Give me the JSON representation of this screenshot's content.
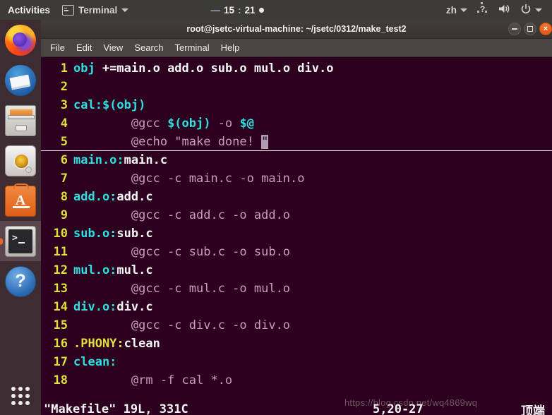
{
  "topbar": {
    "activities": "Activities",
    "app_menu": {
      "label": "Terminal",
      "icon": "terminal-icon"
    },
    "clock": {
      "dash": "—",
      "hours": "15",
      "separator": ":",
      "minutes": "21"
    },
    "input_method": "zh",
    "icons": {
      "ime": "ime-question-icon",
      "volume": "volume-icon",
      "power": "power-icon",
      "menu_arrow": "chevron-down-icon"
    }
  },
  "dock": {
    "items": [
      {
        "name": "firefox",
        "label": "Firefox",
        "active": false
      },
      {
        "name": "thunderbird",
        "label": "Thunderbird Mail",
        "active": false
      },
      {
        "name": "files",
        "label": "Files",
        "active": false
      },
      {
        "name": "rhythmbox",
        "label": "Rhythmbox",
        "active": false
      },
      {
        "name": "ubuntu-software",
        "label": "Ubuntu Software",
        "glyph": "A",
        "active": false
      },
      {
        "name": "terminal",
        "label": "Terminal",
        "active": true
      },
      {
        "name": "help",
        "label": "Help",
        "glyph": "?",
        "active": false
      }
    ],
    "show_applications": "Show Applications"
  },
  "window": {
    "title": "root@jsetc-virtual-machine: ~/jsetc/0312/make_test2",
    "buttons": {
      "minimize": "minimize-button",
      "maximize": "maximize-button",
      "close": "×"
    },
    "menu": [
      "File",
      "Edit",
      "View",
      "Search",
      "Terminal",
      "Help"
    ]
  },
  "editor": {
    "lines": [
      {
        "n": "1",
        "cursorline": false,
        "parts": [
          {
            "t": "obj",
            "c": "c-target"
          },
          {
            "t": " +=main.o add.o sub.o mul.o div.o",
            "c": "c-white"
          }
        ]
      },
      {
        "n": "2",
        "cursorline": false,
        "parts": []
      },
      {
        "n": "3",
        "cursorline": false,
        "parts": [
          {
            "t": "cal:$(obj)",
            "c": "c-target"
          }
        ]
      },
      {
        "n": "4",
        "cursorline": false,
        "parts": [
          {
            "t": "        @gcc ",
            "c": "c-cmd"
          },
          {
            "t": "$(obj)",
            "c": "c-var"
          },
          {
            "t": " -o ",
            "c": "c-cmd"
          },
          {
            "t": "$@",
            "c": "c-var"
          }
        ]
      },
      {
        "n": "5",
        "cursorline": true,
        "parts": [
          {
            "t": "        @echo \"make done! ",
            "c": "c-cmd"
          },
          {
            "t": "\"",
            "c": "c-cmd cursor-blk"
          }
        ]
      },
      {
        "n": "6",
        "cursorline": false,
        "parts": [
          {
            "t": "main.o:",
            "c": "c-target"
          },
          {
            "t": "main.c",
            "c": "c-white"
          }
        ]
      },
      {
        "n": "7",
        "cursorline": false,
        "parts": [
          {
            "t": "        @gcc -c main.c -o main.o",
            "c": "c-cmd"
          }
        ]
      },
      {
        "n": "8",
        "cursorline": false,
        "parts": [
          {
            "t": "add.o:",
            "c": "c-target"
          },
          {
            "t": "add.c",
            "c": "c-white"
          }
        ]
      },
      {
        "n": "9",
        "cursorline": false,
        "parts": [
          {
            "t": "        @gcc -c add.c -o add.o",
            "c": "c-cmd"
          }
        ]
      },
      {
        "n": "10",
        "cursorline": false,
        "parts": [
          {
            "t": "sub.o:",
            "c": "c-target"
          },
          {
            "t": "sub.c",
            "c": "c-white"
          }
        ]
      },
      {
        "n": "11",
        "cursorline": false,
        "parts": [
          {
            "t": "        @gcc -c sub.c -o sub.o",
            "c": "c-cmd"
          }
        ]
      },
      {
        "n": "12",
        "cursorline": false,
        "parts": [
          {
            "t": "mul.o:",
            "c": "c-target"
          },
          {
            "t": "mul.c",
            "c": "c-white"
          }
        ]
      },
      {
        "n": "13",
        "cursorline": false,
        "parts": [
          {
            "t": "        @gcc -c mul.c -o mul.o",
            "c": "c-cmd"
          }
        ]
      },
      {
        "n": "14",
        "cursorline": false,
        "parts": [
          {
            "t": "div.o:",
            "c": "c-target"
          },
          {
            "t": "div.c",
            "c": "c-white"
          }
        ]
      },
      {
        "n": "15",
        "cursorline": false,
        "parts": [
          {
            "t": "        @gcc -c div.c -o div.o",
            "c": "c-cmd"
          }
        ]
      },
      {
        "n": "16",
        "cursorline": false,
        "parts": [
          {
            "t": ".PHONY:",
            "c": "c-yellow"
          },
          {
            "t": "clean",
            "c": "c-white"
          }
        ]
      },
      {
        "n": "17",
        "cursorline": false,
        "parts": [
          {
            "t": "clean:",
            "c": "c-target"
          }
        ]
      },
      {
        "n": "18",
        "cursorline": false,
        "parts": [
          {
            "t": "        @rm -f cal *.o",
            "c": "c-cmd"
          }
        ]
      }
    ]
  },
  "statusline": {
    "file_info": "\"Makefile\" 19L, 331C",
    "position": "5,20-27",
    "scroll_state": "顶端"
  },
  "watermark": "https://blog.csdn.net/wq4869wq"
}
